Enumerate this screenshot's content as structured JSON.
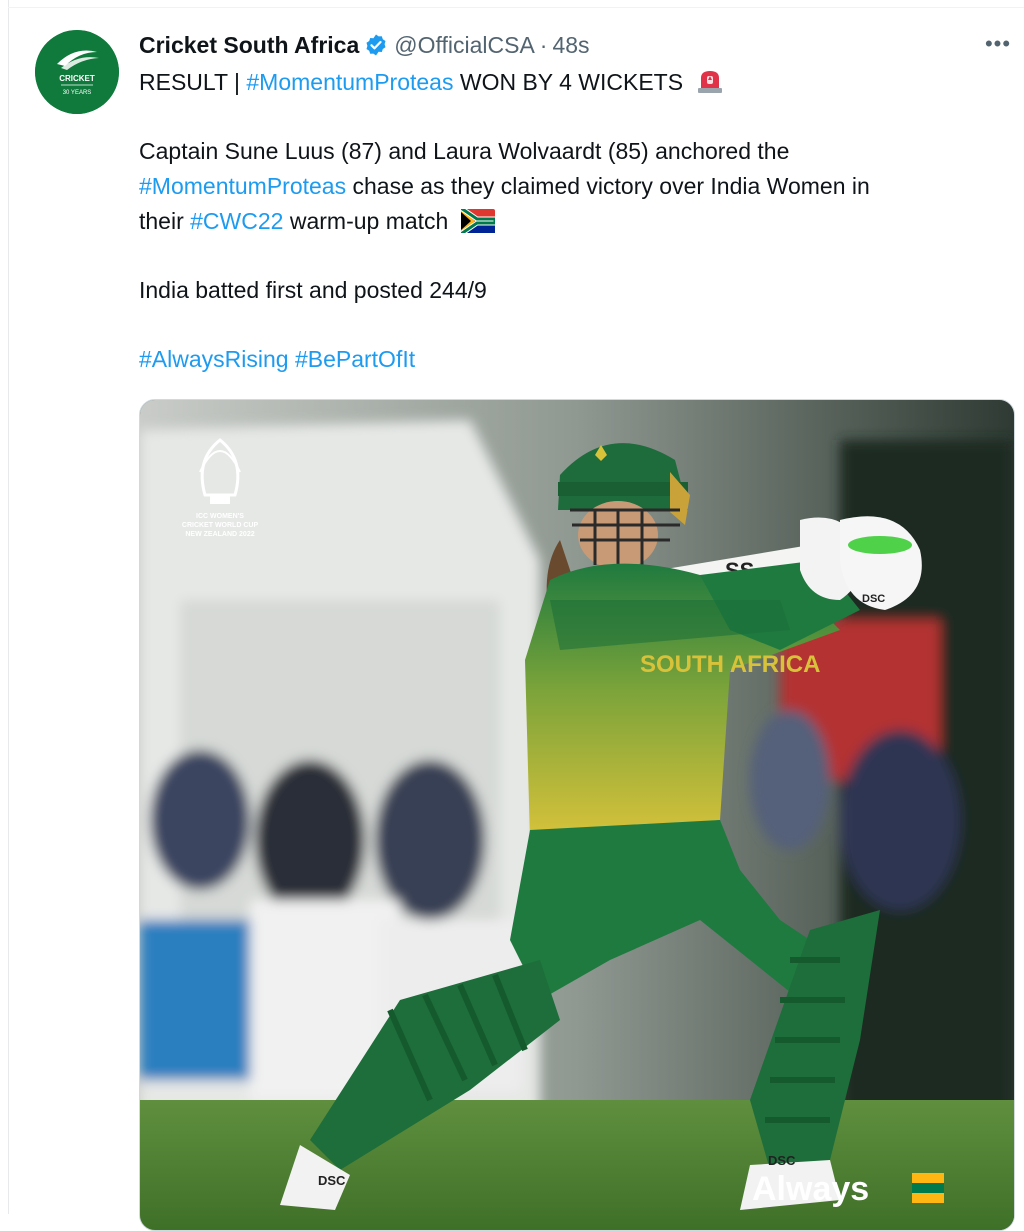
{
  "tweet": {
    "display_name": "Cricket South Africa",
    "handle": "@OfficialCSA",
    "separator": "·",
    "time": "48s",
    "more_label": "•••",
    "line1": {
      "prefix": "RESULT | ",
      "tag": "#MomentumProteas",
      "suffix": " WON BY 4 WICKETS"
    },
    "line2": "Captain Sune Luus (87) and Laura Wolvaardt (85) anchored the",
    "line3": {
      "tag": "#MomentumProteas",
      "suffix": " chase as they claimed victory over India Women in"
    },
    "line4": {
      "prefix": "their ",
      "tag": "#CWC22",
      "suffix": " warm-up match"
    },
    "line5": "India batted first and posted 244/9",
    "hashtags": [
      "#AlwaysRising",
      "#BePartOfIt"
    ]
  },
  "avatar": {
    "icon": "cricket-south-africa-logo",
    "text_top": "CRICKET",
    "text_bottom": "30 YEARS"
  },
  "media": {
    "logo_lines": [
      "ICC WOMEN'S",
      "CRICKET WORLD CUP",
      "NEW ZEALAND 2022"
    ],
    "shirt_text": "SOUTH AFRICA",
    "pad_brand": "DSC",
    "bat_text": "SS",
    "corner_text": "Always"
  },
  "colors": {
    "link": "#1d9bf0",
    "secondary_text": "#536471",
    "verified_badge": "#1d9bf0",
    "brand_green": "#0f7a3c",
    "kit_green": "#1f7a3f",
    "kit_yellow": "#d8c23a"
  }
}
